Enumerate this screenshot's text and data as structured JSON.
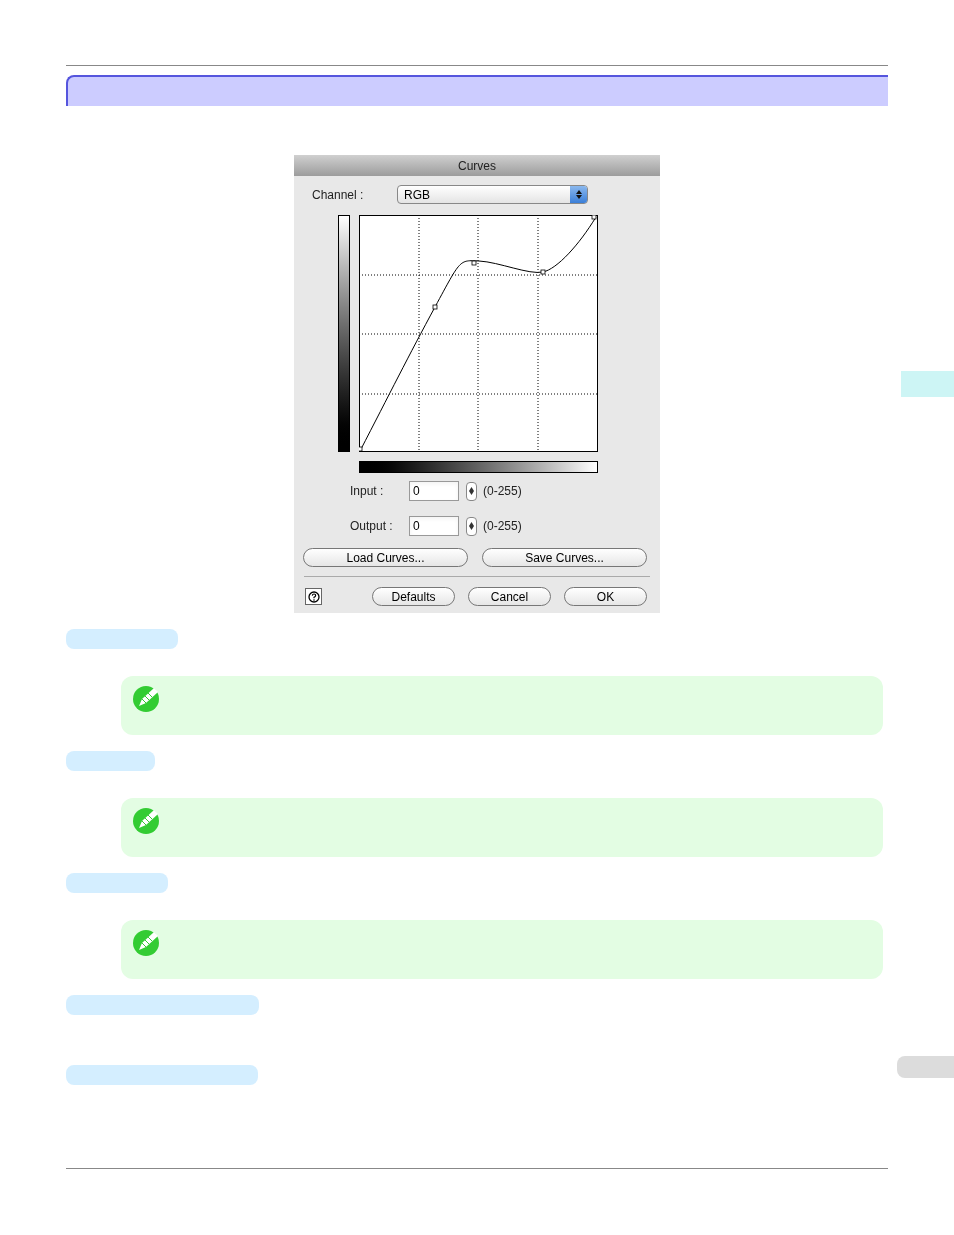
{
  "dialog": {
    "title": "Curves",
    "channel_label": "Channel :",
    "channel_value": "RGB",
    "input": {
      "label": "Input :",
      "value": "0",
      "range": "(0-255)"
    },
    "output": {
      "label": "Output :",
      "value": "0",
      "range": "(0-255)"
    },
    "file_buttons": [
      "Load Curves...",
      "Save Curves..."
    ],
    "buttons": [
      "Defaults",
      "Cancel",
      "OK"
    ]
  },
  "sections": [
    {
      "kind": "label"
    },
    {
      "kind": "note"
    },
    {
      "kind": "label"
    },
    {
      "kind": "note"
    },
    {
      "kind": "label"
    },
    {
      "kind": "note"
    },
    {
      "kind": "label"
    },
    {
      "kind": "label"
    }
  ]
}
